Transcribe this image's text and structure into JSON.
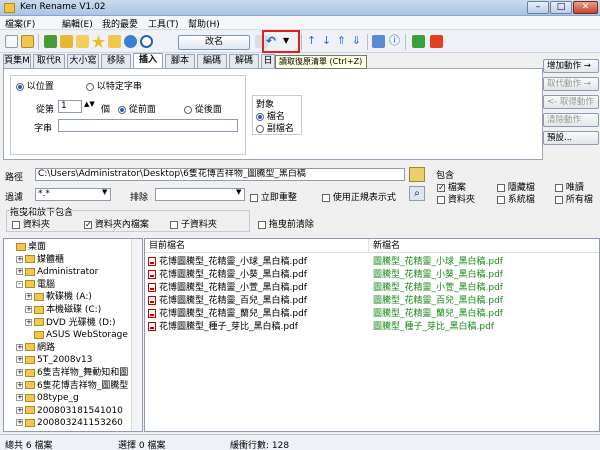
{
  "window": {
    "title": "Ken Rename V1.02",
    "min": "–",
    "max": "□",
    "close": "✕"
  },
  "menu": [
    "檔案(F)",
    "編輯(E)",
    "我的最愛",
    "工具(T)",
    "幫助(H)"
  ],
  "toolbar": {
    "rename_label": "改名",
    "tooltip": "讀取復原清單 (Ctrl+Z)"
  },
  "tabs": [
    "頁集M",
    "取代R",
    "大小寫",
    "移除",
    "插入",
    "腳本",
    "編碼",
    "解碼",
    "日"
  ],
  "insert": {
    "by_position": "以位置",
    "by_string": "以特定字串",
    "from_label": "從第",
    "from_value": "1",
    "unit": "個",
    "before": "從前面",
    "after": "從後面",
    "string_label": "字串",
    "string_value": "",
    "target_label": "對象",
    "target_filename": "檔名",
    "target_ext": "副檔名"
  },
  "actions": {
    "add": "增加動作 →",
    "replace": "取代動作 →",
    "get": "<- 取得動作",
    "clear": "清除動作",
    "preset": "預設..."
  },
  "path": {
    "label": "路徑",
    "value": "C:\\Users\\Administrator\\Desktop\\6隻花博吉祥物_圖騰型_黑白稿"
  },
  "filter": {
    "label": "過濾",
    "value": "*.*",
    "exclude_label": "排除",
    "exclude_value": "",
    "instant": "立即重整",
    "regex": "使用正規表示式"
  },
  "include": {
    "label": "包含",
    "files": "檔案",
    "hidden": "隱藏檔",
    "readonly": "唯讀",
    "folders": "資料夾",
    "system": "系統檔",
    "all": "所有檔"
  },
  "drag": {
    "label": "拖曳和放下包含",
    "folder": "資料夾",
    "folder_files": "資料夾內檔案",
    "subfolder": "子資料夾",
    "clear_before": "拖曳前清除"
  },
  "tree": [
    {
      "label": "桌面",
      "indent": 0,
      "exp": ""
    },
    {
      "label": "媒體櫃",
      "indent": 1,
      "exp": "+"
    },
    {
      "label": "Administrator",
      "indent": 1,
      "exp": "+"
    },
    {
      "label": "電腦",
      "indent": 1,
      "exp": "-"
    },
    {
      "label": "軟碟機 (A:)",
      "indent": 2,
      "exp": "+"
    },
    {
      "label": "本機磁碟 (C:)",
      "indent": 2,
      "exp": "+"
    },
    {
      "label": "DVD 光碟機 (D:)",
      "indent": 2,
      "exp": "+"
    },
    {
      "label": "ASUS WebStorage",
      "indent": 2,
      "exp": ""
    },
    {
      "label": "網路",
      "indent": 1,
      "exp": "+"
    },
    {
      "label": "5T_2008v13",
      "indent": 1,
      "exp": "+"
    },
    {
      "label": "6隻吉祥物_舞動知和圖",
      "indent": 1,
      "exp": "+"
    },
    {
      "label": "6隻花博吉祥物_圖騰型",
      "indent": 1,
      "exp": "+"
    },
    {
      "label": "08type_g",
      "indent": 1,
      "exp": "+"
    },
    {
      "label": "200803181541010",
      "indent": 1,
      "exp": "+"
    },
    {
      "label": "200803241153260",
      "indent": 1,
      "exp": "+"
    }
  ],
  "files": {
    "col_current": "目前檔名",
    "col_new": "新檔名",
    "rows": [
      {
        "current": "花博圖騰型_花精靈_小球_黑白稿.pdf",
        "new": "圖騰型_花精靈_小球_黑白稿.pdf"
      },
      {
        "current": "花博圖騰型_花精靈_小葵_黑白稿.pdf",
        "new": "圖騰型_花精靈_小葵_黑白稿.pdf"
      },
      {
        "current": "花博圖騰型_花精靈_小萱_黑白稿.pdf",
        "new": "圖騰型_花精靈_小萱_黑白稿.pdf"
      },
      {
        "current": "花博圖騰型_花精靈_百兒_黑白稿.pdf",
        "new": "圖騰型_花精靈_百兒_黑白稿.pdf"
      },
      {
        "current": "花博圖騰型_花精靈_蘭兒_黑白稿.pdf",
        "new": "圖騰型_花精靈_蘭兒_黑白稿.pdf"
      },
      {
        "current": "花博圖騰型_種子_芽比_黑白稿.pdf",
        "new": "圖騰型_種子_芽比_黑白稿.pdf"
      }
    ]
  },
  "status": {
    "total": "總共 6 檔案",
    "selected": "選擇 0 檔案",
    "cache": "緩衝行數: 128"
  }
}
